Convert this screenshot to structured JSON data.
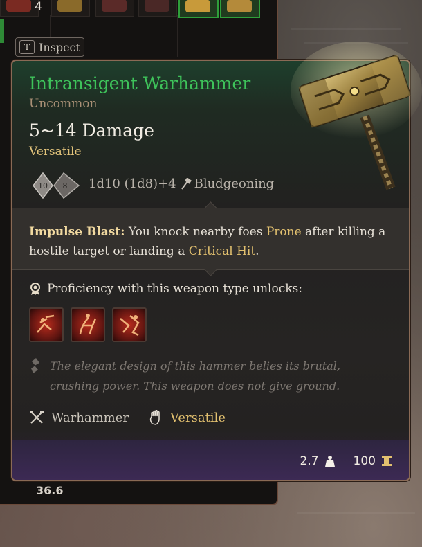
{
  "inventory": {
    "stack_count": "4",
    "inspect_key": "T",
    "inspect_label": "Inspect",
    "weight_total": "36.6"
  },
  "tooltip": {
    "name": "Intransigent Warhammer",
    "rarity": "Uncommon",
    "damage": "5~14 Damage",
    "property": "Versatile",
    "dice": [
      "10",
      "8"
    ],
    "dice_formula": "1d10 (1d8)+4",
    "damage_type": "Bludgeoning",
    "passive_name": "Impulse Blast:",
    "passive_text_1": " You knock nearby foes ",
    "passive_keyword_1": "Prone",
    "passive_text_2": " after killing a hostile target or landing a ",
    "passive_keyword_2": "Critical Hit",
    "passive_text_3": ".",
    "proficiency_header": "Proficiency with this weapon type unlocks:",
    "proficiency_actions": [
      "action-icon-1",
      "action-icon-2",
      "action-icon-3"
    ],
    "lore": "The elegant design of this hammer belies its brutal, crushing power. This weapon does not give ground.",
    "tag_weapon": "Warhammer",
    "tag_property": "Versatile",
    "weight": "2.7",
    "value": "100"
  },
  "colors": {
    "name_green": "#3ec25a",
    "rarity": "#a88f75",
    "keyword_gold": "#e2c06f",
    "footer_purple": "#3d2a55"
  }
}
